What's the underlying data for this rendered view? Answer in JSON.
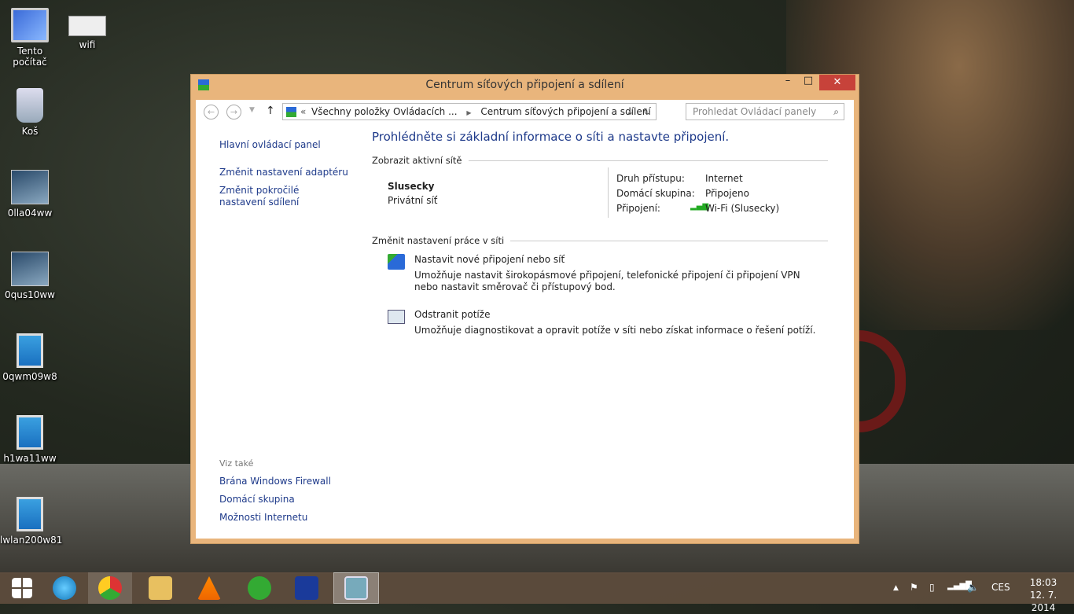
{
  "desktop": {
    "icons": [
      {
        "label": "Tento počítač",
        "icon": "computer-icon"
      },
      {
        "label": "wifi",
        "icon": "image-thumbnail-icon"
      },
      {
        "label": "Koš",
        "icon": "recycle-bin-icon"
      },
      {
        "label": "0lla04ww",
        "icon": "setup-icon"
      },
      {
        "label": "0qus10ww",
        "icon": "setup-icon"
      },
      {
        "label": "0qwm09w8",
        "icon": "installer-icon"
      },
      {
        "label": "h1wa11ww",
        "icon": "installer-icon"
      },
      {
        "label": "lwlan200w81",
        "icon": "installer-icon"
      }
    ]
  },
  "window": {
    "title": "Centrum síťových připojení a sdílení",
    "address": {
      "parent": "Všechny položky Ovládacích ...",
      "current": "Centrum síťových připojení a sdílení",
      "search_placeholder": "Prohledat Ovládací panely"
    },
    "sidebar": {
      "home": "Hlavní ovládací panel",
      "adapter": "Změnit nastavení adaptéru",
      "advanced": "Změnit pokročilé nastavení sdílení",
      "see_also": "Viz také",
      "links": [
        "Brána Windows Firewall",
        "Domácí skupina",
        "Možnosti Internetu"
      ]
    },
    "main": {
      "heading": "Prohlédněte si základní informace o síti a nastavte připojení.",
      "active_section": "Zobrazit aktivní sítě",
      "network_name": "Slusecky",
      "network_type": "Privátní síť",
      "access_label": "Druh přístupu:",
      "access_value": "Internet",
      "homegroup_label": "Domácí skupina:",
      "homegroup_value": "Připojeno",
      "connection_label": "Připojení:",
      "connection_value": "Wi-Fi (Slusecky)",
      "change_section": "Změnit nastavení práce v síti",
      "tasks": [
        {
          "title": "Nastavit nové připojení nebo síť",
          "desc": "Umožňuje nastavit širokopásmové připojení, telefonické připojení či připojení VPN nebo nastavit směrovač či přístupový bod."
        },
        {
          "title": "Odstranit potíže",
          "desc": "Umožňuje diagnostikovat a opravit potíže v síti nebo získat informace o řešení potíží."
        }
      ]
    }
  },
  "taskbar": {
    "language": "CES",
    "time": "18:03",
    "date": "12. 7. 2014"
  }
}
